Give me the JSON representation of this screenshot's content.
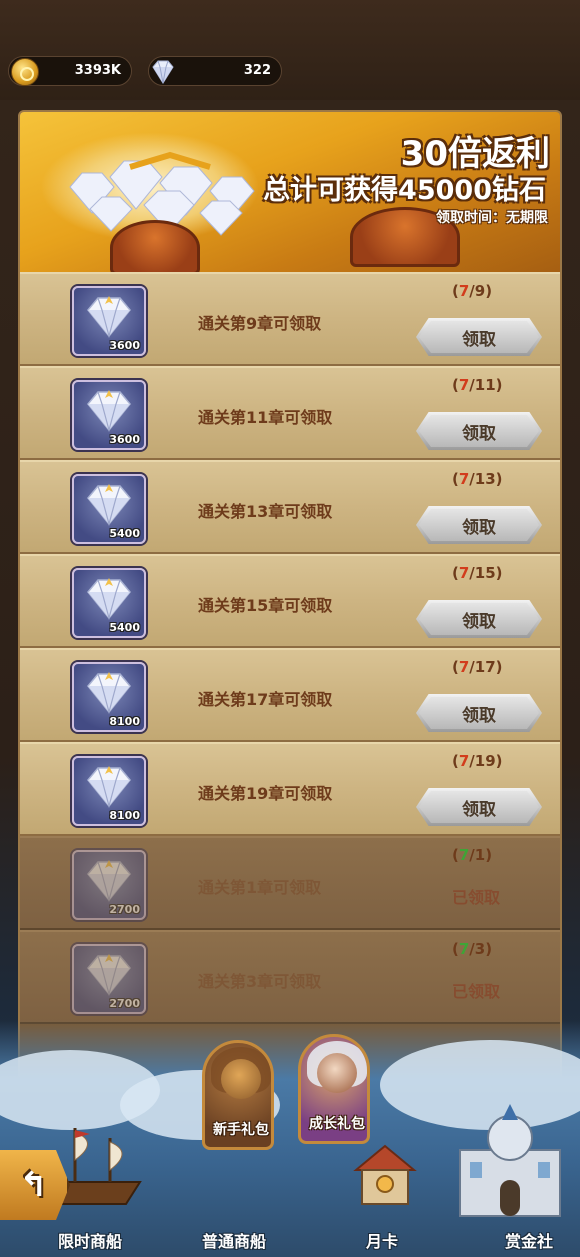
{
  "currency": {
    "gold": "3393K",
    "gems": "322"
  },
  "banner": {
    "multiplier_num": "30",
    "multiplier_text": "倍返利",
    "total_line": "总计可获得45000钻石",
    "claim_time": "领取时间：无期限"
  },
  "rows": [
    {
      "amount": "3600",
      "label": "通关第9章可领取",
      "current": "7",
      "target": "/9",
      "button": "领取",
      "claimed": false
    },
    {
      "amount": "3600",
      "label": "通关第11章可领取",
      "current": "7",
      "target": "/11",
      "button": "领取",
      "claimed": false
    },
    {
      "amount": "5400",
      "label": "通关第13章可领取",
      "current": "7",
      "target": "/13",
      "button": "领取",
      "claimed": false
    },
    {
      "amount": "5400",
      "label": "通关第15章可领取",
      "current": "7",
      "target": "/15",
      "button": "领取",
      "claimed": false
    },
    {
      "amount": "8100",
      "label": "通关第17章可领取",
      "current": "7",
      "target": "/17",
      "button": "领取",
      "claimed": false
    },
    {
      "amount": "8100",
      "label": "通关第19章可领取",
      "current": "7",
      "target": "/19",
      "button": "领取",
      "claimed": false
    },
    {
      "amount": "2700",
      "label": "通关第1章可领取",
      "current": "7",
      "target": "/1",
      "status": "已领取",
      "claimed": true
    },
    {
      "amount": "2700",
      "label": "通关第3章可领取",
      "current": "7",
      "target": "/3",
      "status": "已领取",
      "claimed": true
    }
  ],
  "cards": {
    "newbie": "新手礼包",
    "growth": "成长礼包"
  },
  "nav": {
    "limited_shop": "限时商船",
    "normal_shop": "普通商船",
    "monthly": "月卡",
    "bounty": "赏金社"
  }
}
